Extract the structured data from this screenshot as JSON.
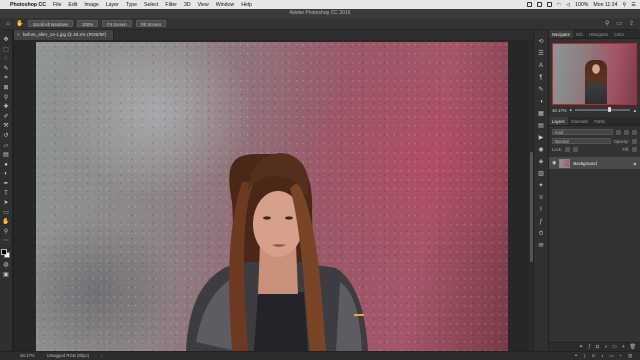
{
  "menubar": {
    "app_name": "Photoshop CC",
    "menus": [
      "File",
      "Edit",
      "Image",
      "Layer",
      "Type",
      "Select",
      "Filter",
      "3D",
      "View",
      "Window",
      "Help"
    ],
    "battery": "100%",
    "clock": "Mon 11:24"
  },
  "window": {
    "title": "Adobe Photoshop CC 2019"
  },
  "options": {
    "scroll_all_windows": "Scroll All Windows",
    "zoom_100": "100%",
    "fit_screen": "Fit Screen",
    "fill_screen": "Fill Screen"
  },
  "document": {
    "tab_title": "before_after_14-1.jpg @ 48.2% (RGB/8#)"
  },
  "statusbar": {
    "zoom": "48.17%",
    "doc_info": "Untagged RGB (8bpc)"
  },
  "panels": {
    "nav_tabs": [
      "Navigator",
      "Info",
      "Histogram",
      "Color"
    ],
    "nav_zoom": "48.17%",
    "layer_tabs": [
      "Layers",
      "Channels",
      "Paths"
    ],
    "kind_label": "Kind",
    "blend_mode": "Normal",
    "opacity_label": "Opacity:",
    "lock_label": "Lock:",
    "fill_label": "Fill:",
    "layer_name": "Background"
  },
  "colors": {
    "accent_frame": "#c0262e",
    "panel_bg": "#323232",
    "menubar_bg": "#e6e6e6"
  }
}
